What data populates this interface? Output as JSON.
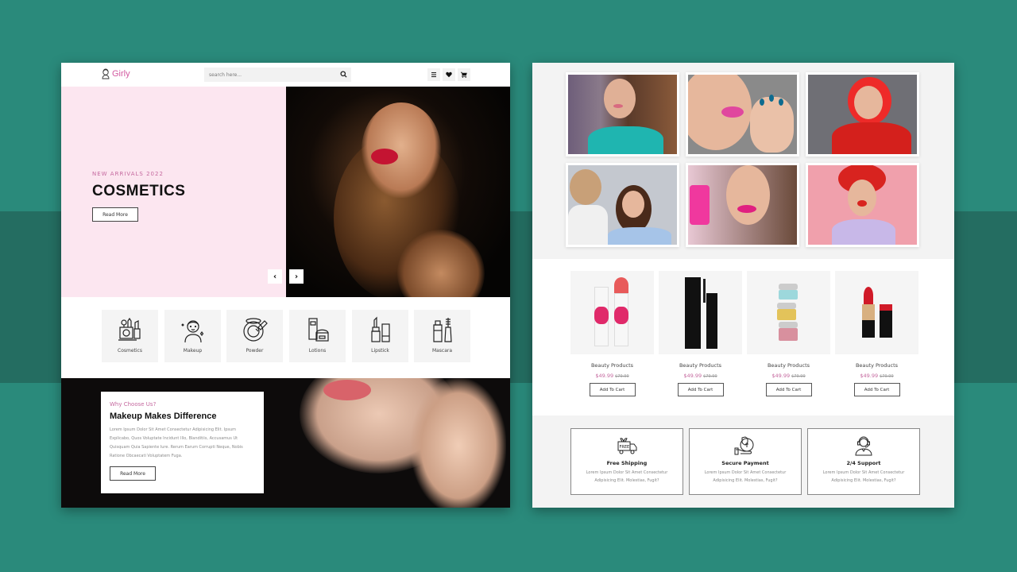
{
  "colors": {
    "accent_pink": "#c5699f",
    "background_teal": "#2a8a7b",
    "band_teal": "#246d61",
    "hero_pink": "#fce6f0"
  },
  "header": {
    "logo_text": "Girly",
    "search_placeholder": "search here...",
    "icons": [
      "menu-icon",
      "heart-icon",
      "cart-icon"
    ]
  },
  "hero": {
    "subtitle": "NEW ARRIVALS 2022",
    "title": "COSMETICS",
    "button_label": "Read More",
    "prev_label": "‹",
    "next_label": "›"
  },
  "categories": [
    {
      "label": "Cosmetics",
      "icon": "cosmetics-icon"
    },
    {
      "label": "Makeup",
      "icon": "makeup-icon"
    },
    {
      "label": "Powder",
      "icon": "powder-icon"
    },
    {
      "label": "Lotions",
      "icon": "lotions-icon"
    },
    {
      "label": "Lipstick",
      "icon": "lipstick-icon"
    },
    {
      "label": "Mascara",
      "icon": "mascara-icon"
    }
  ],
  "why": {
    "subtitle": "Why Choose Us?",
    "title": "Makeup Makes Difference",
    "text": "Lorem Ipsum Dolor Sit Amet Consectetur Adipisicing Elit. Ipsum Explicabo, Quos Voluptate Incidunt Illo, Blanditiis, Accusamus Ut Quisquam Quia Sapiente Iure. Rerum Earum Corrupti Neque, Nobis Ratione Obcaecati Voluptatem Fuga.",
    "button_label": "Read More"
  },
  "gallery": [
    {
      "alt": "woman applying lip gloss"
    },
    {
      "alt": "woman with blue nails and pink lips"
    },
    {
      "alt": "woman with red hair and red jacket"
    },
    {
      "alt": "makeup artist applying blush"
    },
    {
      "alt": "smiling woman with pink phone and lipstick"
    },
    {
      "alt": "woman in red beret applying lipstick"
    }
  ],
  "products": {
    "prev_label": "‹",
    "next_label": "›",
    "items": [
      {
        "name": "Beauty Products",
        "price": "$49.99",
        "old_price": "$79.99",
        "button_label": "Add To Cart",
        "image": "pink-lipstick-tubes"
      },
      {
        "name": "Beauty Products",
        "price": "$49.99",
        "old_price": "$79.99",
        "button_label": "Add To Cart",
        "image": "black-mascara"
      },
      {
        "name": "Beauty Products",
        "price": "$49.99",
        "old_price": "$79.99",
        "button_label": "Add To Cart",
        "image": "cream-jars"
      },
      {
        "name": "Beauty Products",
        "price": "$49.99",
        "old_price": "$79.99",
        "button_label": "Add To Cart",
        "image": "red-lipstick"
      }
    ]
  },
  "features": [
    {
      "title": "Free Shipping",
      "text": "Lorem Ipsum Dolor Sit Amet Consectetur Adipisicing Elit. Molestias, Fugit?",
      "icon": "free-shipping-truck-icon",
      "badge": "FREE"
    },
    {
      "title": "Secure Payment",
      "text": "Lorem Ipsum Dolor Sit Amet Consectetur Adipisicing Elit. Molestias, Fugit?",
      "icon": "secure-payment-icon"
    },
    {
      "title": "2/4 Support",
      "text": "Lorem Ipsum Dolor Sit Amet Consectetur Adipisicing Elit. Molestias, Fugit?",
      "icon": "support-headset-icon"
    }
  ]
}
